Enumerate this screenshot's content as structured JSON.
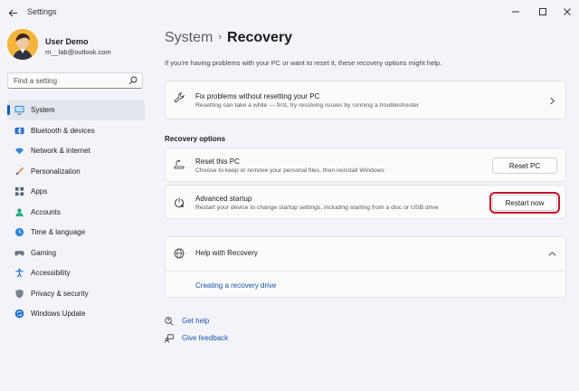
{
  "window": {
    "title": "Settings"
  },
  "user": {
    "name": "User Demo",
    "email": "m__lab@outlook.com"
  },
  "search": {
    "placeholder": "Find a setting"
  },
  "nav": [
    {
      "label": "System",
      "icon": "monitor-icon",
      "active": true
    },
    {
      "label": "Bluetooth & devices",
      "icon": "bluetooth-icon"
    },
    {
      "label": "Network & internet",
      "icon": "wifi-icon"
    },
    {
      "label": "Personalization",
      "icon": "brush-icon"
    },
    {
      "label": "Apps",
      "icon": "apps-icon"
    },
    {
      "label": "Accounts",
      "icon": "person-icon"
    },
    {
      "label": "Time & language",
      "icon": "globe-clock-icon"
    },
    {
      "label": "Gaming",
      "icon": "gamepad-icon"
    },
    {
      "label": "Accessibility",
      "icon": "accessibility-icon"
    },
    {
      "label": "Privacy & security",
      "icon": "shield-icon"
    },
    {
      "label": "Windows Update",
      "icon": "sync-icon"
    }
  ],
  "breadcrumb": {
    "parent": "System",
    "separator": "›",
    "current": "Recovery"
  },
  "intro": "If you're having problems with your PC or want to reset it, these recovery options might help.",
  "fix_card": {
    "title": "Fix problems without resetting your PC",
    "desc": "Resetting can take a while — first, try resolving issues by running a troubleshooter"
  },
  "recovery_options": {
    "heading": "Recovery options",
    "reset": {
      "title": "Reset this PC",
      "desc": "Choose to keep or remove your personal files, then reinstall Windows",
      "button": "Reset PC"
    },
    "advanced": {
      "title": "Advanced startup",
      "desc": "Restart your device to change startup settings, including starting from a disc or USB drive",
      "button": "Restart now"
    }
  },
  "help": {
    "title": "Help with Recovery",
    "link": "Creating a recovery drive"
  },
  "footer": {
    "get_help": "Get help",
    "give_feedback": "Give feedback"
  },
  "colors": {
    "accent": "#005fb8",
    "highlight": "#c8102e",
    "link": "#1a56a8"
  }
}
